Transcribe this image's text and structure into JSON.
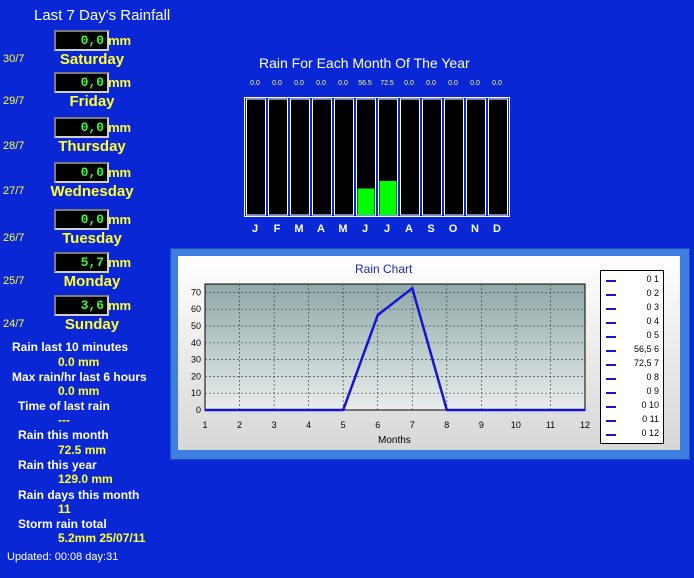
{
  "header": {
    "title": "Last 7 Day's Rainfall"
  },
  "unit": "mm",
  "days": [
    {
      "date": "30/7",
      "value": "0,0",
      "name": "Saturday"
    },
    {
      "date": "29/7",
      "value": "0,0",
      "name": "Friday"
    },
    {
      "date": "28/7",
      "value": "0,0",
      "name": "Thursday"
    },
    {
      "date": "27/7",
      "value": "0,0",
      "name": "Wednesday"
    },
    {
      "date": "26/7",
      "value": "0,0",
      "name": "Tuesday"
    },
    {
      "date": "25/7",
      "value": "5,7",
      "name": "Monday"
    },
    {
      "date": "24/7",
      "value": "3,6",
      "name": "Sunday"
    }
  ],
  "stats": [
    {
      "label": "Rain last 10 minutes",
      "value": "0.0 mm"
    },
    {
      "label": "Max rain/hr last 6 hours",
      "value": "0.0 mm"
    },
    {
      "label": "Time of last rain",
      "value": "---"
    },
    {
      "label": "Rain this month",
      "value": "72.5 mm"
    },
    {
      "label": "Rain this year",
      "value": "129.0 mm"
    },
    {
      "label": "Rain days this month",
      "value": "11"
    },
    {
      "label": "Storm rain total",
      "value": "5.2mm 25/07/11"
    }
  ],
  "updated": "Updated: 00:08 day:31",
  "monthly": {
    "title": "Rain For Each Month Of The Year",
    "values": [
      "0.0",
      "0.0",
      "0.0",
      "0.0",
      "0.0",
      "56.5",
      "72.5",
      "0.0",
      "0.0",
      "0.0",
      "0.0",
      "0.0"
    ],
    "letters": [
      "J",
      "F",
      "M",
      "A",
      "M",
      "J",
      "J",
      "A",
      "S",
      "O",
      "N",
      "D"
    ],
    "bar_color": "#00ff00",
    "bar_max": 72.5
  },
  "chart_data": {
    "type": "line",
    "title": "Rain Chart",
    "xlabel": "Months",
    "ylabel": "",
    "x": [
      1,
      2,
      3,
      4,
      5,
      6,
      7,
      8,
      9,
      10,
      11,
      12
    ],
    "y_ticks": [
      0,
      10,
      20,
      30,
      40,
      50,
      60,
      70
    ],
    "xlim": [
      1,
      12
    ],
    "ylim": [
      0,
      75
    ],
    "grid": true,
    "legend_position": "right",
    "line_color": "#1414d8",
    "series": [
      {
        "values": [
          0,
          0,
          0,
          0,
          0,
          56.5,
          72.5,
          0,
          0,
          0,
          0,
          0
        ]
      }
    ],
    "legend": [
      "0 1",
      "0 2",
      "0 3",
      "0 4",
      "0 5",
      "56,5 6",
      "72,5 7",
      "0 8",
      "0 9",
      "0 10",
      "0 11",
      "0 12"
    ]
  }
}
